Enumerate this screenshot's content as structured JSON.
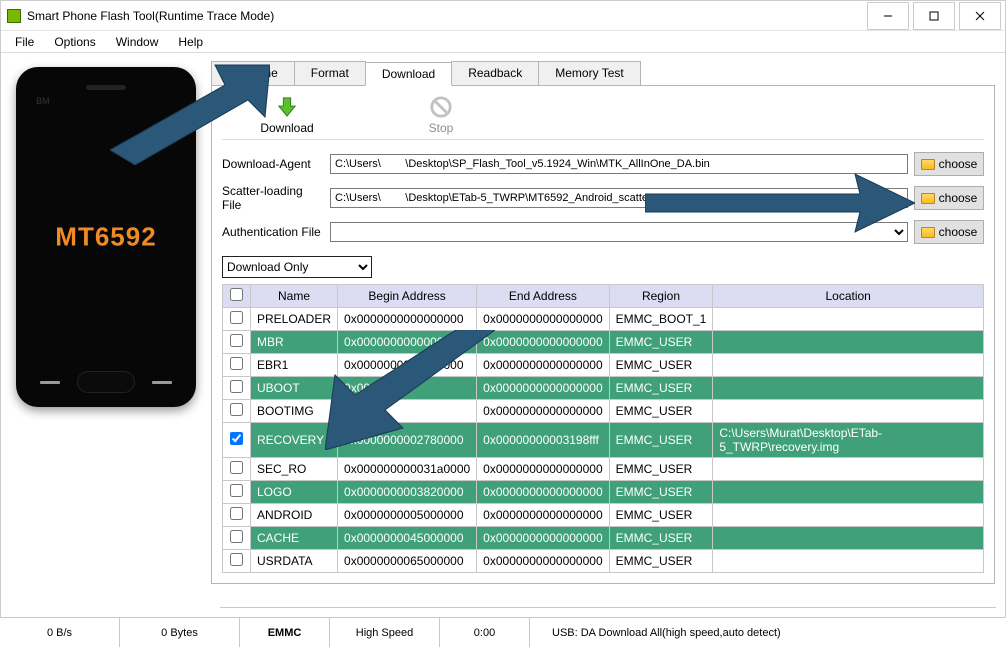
{
  "window": {
    "title": "Smart Phone Flash Tool(Runtime Trace Mode)"
  },
  "menu": {
    "file": "File",
    "options": "Options",
    "window": "Window",
    "help": "Help"
  },
  "phone": {
    "chip": "MT6592",
    "brand": "BM"
  },
  "tabs": {
    "welcome": "Welcome",
    "format": "Format",
    "download": "Download",
    "readback": "Readback",
    "memory": "Memory Test"
  },
  "toolbar": {
    "download": "Download",
    "stop": "Stop"
  },
  "filerows": {
    "da_label": "Download-Agent",
    "da_path": "C:\\Users\\        \\Desktop\\SP_Flash_Tool_v5.1924_Win\\MTK_AllInOne_DA.bin",
    "scatter_label": "Scatter-loading File",
    "scatter_path": "C:\\Users\\        \\Desktop\\ETab-5_TWRP\\MT6592_Android_scatter.txt",
    "auth_label": "Authentication File",
    "auth_path": "",
    "choose": "choose"
  },
  "mode": {
    "selected": "Download Only"
  },
  "table": {
    "headers": {
      "name": "Name",
      "begin": "Begin Address",
      "end": "End Address",
      "region": "Region",
      "location": "Location"
    },
    "rows": [
      {
        "checked": false,
        "hl": false,
        "name": "PRELOADER",
        "begin": "0x0000000000000000",
        "end": "0x0000000000000000",
        "region": "EMMC_BOOT_1",
        "location": ""
      },
      {
        "checked": false,
        "hl": true,
        "name": "MBR",
        "begin": "0x0000000000000000",
        "end": "0x0000000000000000",
        "region": "EMMC_USER",
        "location": ""
      },
      {
        "checked": false,
        "hl": false,
        "name": "EBR1",
        "begin": "0x0000000000080000",
        "end": "0x0000000000000000",
        "region": "EMMC_USER",
        "location": ""
      },
      {
        "checked": false,
        "hl": true,
        "name": "UBOOT",
        "begin": "0x0000000",
        "end": "0x0000000000000000",
        "region": "EMMC_USER",
        "location": ""
      },
      {
        "checked": false,
        "hl": false,
        "name": "BOOTIMG",
        "begin": "0x000",
        "end": "0x0000000000000000",
        "region": "EMMC_USER",
        "location": ""
      },
      {
        "checked": true,
        "hl": true,
        "name": "RECOVERY",
        "begin": "0x0000000002780000",
        "end": "0x00000000003198fff",
        "region": "EMMC_USER",
        "location": "C:\\Users\\Murat\\Desktop\\ETab-5_TWRP\\recovery.img"
      },
      {
        "checked": false,
        "hl": false,
        "name": "SEC_RO",
        "begin": "0x000000000031a0000",
        "end": "0x0000000000000000",
        "region": "EMMC_USER",
        "location": ""
      },
      {
        "checked": false,
        "hl": true,
        "name": "LOGO",
        "begin": "0x0000000003820000",
        "end": "0x0000000000000000",
        "region": "EMMC_USER",
        "location": ""
      },
      {
        "checked": false,
        "hl": false,
        "name": "ANDROID",
        "begin": "0x0000000005000000",
        "end": "0x0000000000000000",
        "region": "EMMC_USER",
        "location": ""
      },
      {
        "checked": false,
        "hl": true,
        "name": "CACHE",
        "begin": "0x0000000045000000",
        "end": "0x0000000000000000",
        "region": "EMMC_USER",
        "location": ""
      },
      {
        "checked": false,
        "hl": false,
        "name": "USRDATA",
        "begin": "0x0000000065000000",
        "end": "0x0000000000000000",
        "region": "EMMC_USER",
        "location": ""
      }
    ]
  },
  "status": {
    "speed": "0 B/s",
    "bytes": "0 Bytes",
    "storage": "EMMC",
    "mode": "High Speed",
    "time": "0:00",
    "usb": "USB: DA Download All(high speed,auto detect)"
  }
}
